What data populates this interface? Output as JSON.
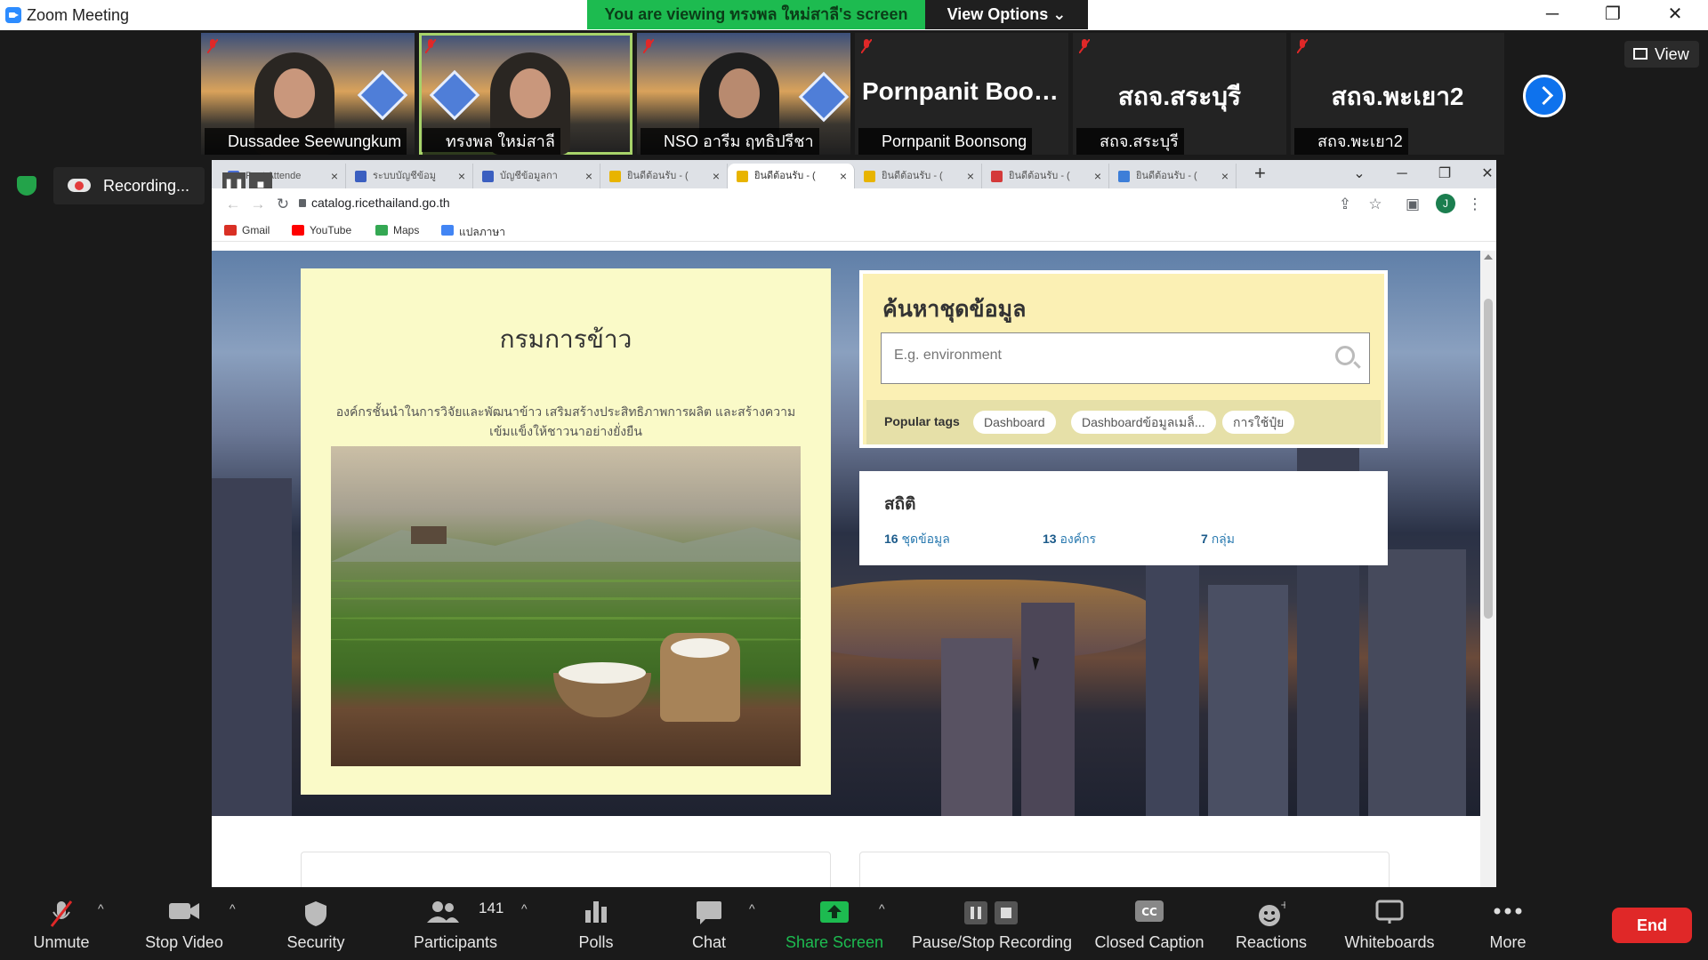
{
  "window": {
    "title": "Zoom Meeting",
    "minimize": "─",
    "restore": "❐",
    "close": "✕"
  },
  "banner": {
    "viewing_text": "You are viewing ทรงพล ใหม่สาลี's screen",
    "view_options": "View Options ⌄"
  },
  "participants": [
    {
      "name": "Dussadee Seewungkum",
      "big_name": ""
    },
    {
      "name": "ทรงพล ใหม่สาลี",
      "big_name": ""
    },
    {
      "name": "NSO อารีม  ฤทธิปรีชา",
      "big_name": ""
    },
    {
      "name": "Pornpanit Boonsong",
      "big_name": "Pornpanit  Boon..."
    },
    {
      "name": "สถจ.สระบุรี",
      "big_name": "สถจ.สระบุรี"
    },
    {
      "name": "สถจ.พะเยา2",
      "big_name": "สถจ.พะเยา2"
    }
  ],
  "view_button": "View",
  "recording": {
    "label": "Recording...",
    "pause": "❚❚",
    "stop": "■"
  },
  "browser": {
    "tabs": [
      {
        "title": "Post Attende",
        "color": "#4a6fd8"
      },
      {
        "title": "ระบบบัญชีข้อมู",
        "color": "#3b5fc0"
      },
      {
        "title": "บัญชีข้อมูลกา",
        "color": "#3b5fc0"
      },
      {
        "title": "ยินดีต้อนรับ - (",
        "color": "#e8b400"
      },
      {
        "title": "ยินดีต้อนรับ - (",
        "color": "#e8b400"
      },
      {
        "title": "ยินดีต้อนรับ - (",
        "color": "#e8b400"
      },
      {
        "title": "ยินดีต้อนรับ - (",
        "color": "#d43a3a"
      },
      {
        "title": "ยินดีต้อนรับ - (",
        "color": "#3d7ed8"
      }
    ],
    "new_tab": "+",
    "url": "catalog.ricethailand.go.th",
    "profile_initial": "J",
    "bookmarks": [
      {
        "label": "Gmail",
        "color": "#d93025"
      },
      {
        "label": "YouTube",
        "color": "#ff0000"
      },
      {
        "label": "Maps",
        "color": "#34a853"
      },
      {
        "label": "แปลภาษา",
        "color": "#4285f4"
      }
    ]
  },
  "page": {
    "org_title": "กรมการข้าว",
    "org_desc": "องค์กรชั้นนำในการวิจัยและพัฒนาข้าว เสริมสร้างประสิทธิภาพการผลิต และสร้างความเข้มแข็งให้ชาวนาอย่างยั่งยืน",
    "search_title": "ค้นหาชุดข้อมูล",
    "search_placeholder": "E.g. environment",
    "popular_tags_label": "Popular tags",
    "tags": [
      "Dashboard",
      "Dashboardข้อมูลเมล็...",
      "การใช้ปุ๋ย"
    ],
    "stats_title": "สถิติ",
    "stats": [
      {
        "count": "16",
        "label": "ชุดข้อมูล"
      },
      {
        "count": "13",
        "label": "องค์กร"
      },
      {
        "count": "7",
        "label": "กลุ่ม"
      }
    ]
  },
  "toolbar": {
    "unmute": "Unmute",
    "stop_video": "Stop Video",
    "security": "Security",
    "participants": "Participants",
    "participants_count": "141",
    "polls": "Polls",
    "chat": "Chat",
    "share_screen": "Share Screen",
    "pause_stop_recording": "Pause/Stop Recording",
    "closed_caption": "Closed Caption",
    "reactions": "Reactions",
    "whiteboards": "Whiteboards",
    "more": "More",
    "end": "End",
    "share_color": "#1dbb50",
    "end_color": "#e02828"
  }
}
